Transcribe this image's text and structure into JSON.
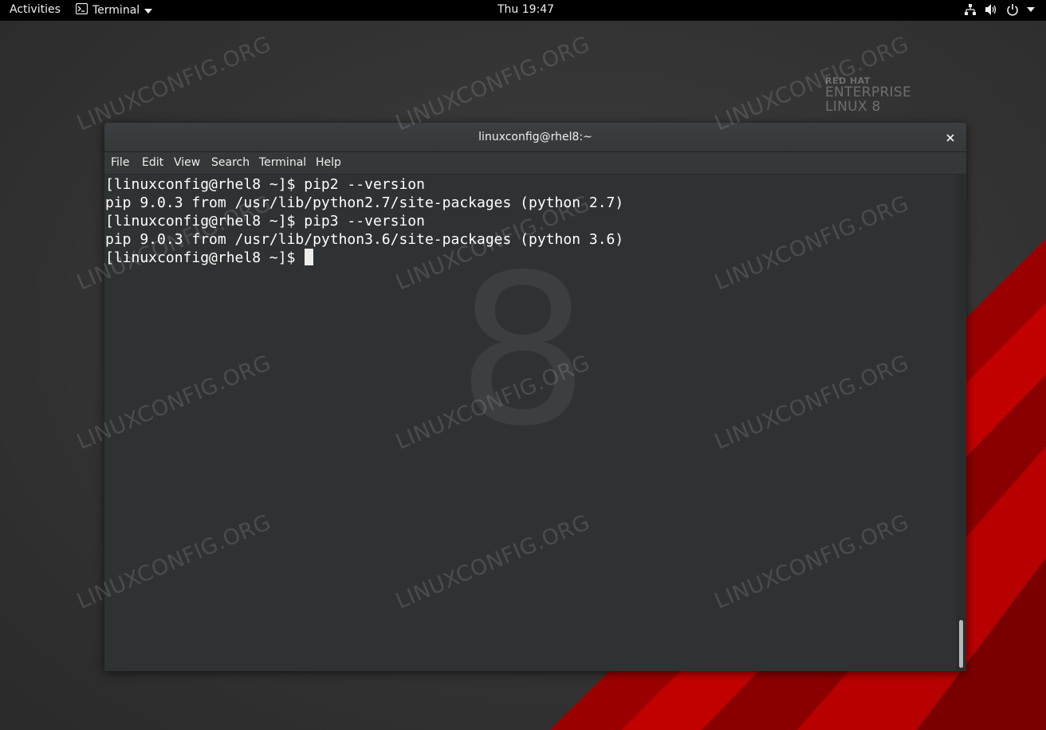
{
  "topbar": {
    "activities": "Activities",
    "app_name": "Terminal",
    "clock": "Thu 19:47",
    "icons": [
      "terminal-icon",
      "network-icon",
      "volume-icon",
      "power-icon",
      "dropdown-arrow-icon"
    ]
  },
  "wallpaper": {
    "brand_line1": "RED HAT",
    "brand_line2": "ENTERPRISE",
    "brand_line3": "LINUX 8",
    "big_numeral": "8",
    "accent_color": "#c00000"
  },
  "watermark": "LINUXCONFIG.ORG",
  "window": {
    "title": "linuxconfig@rhel8:~",
    "menu": [
      "File",
      "Edit",
      "View",
      "Search",
      "Terminal",
      "Help"
    ]
  },
  "terminal": {
    "lines": [
      "[linuxconfig@rhel8 ~]$ pip2 --version",
      "pip 9.0.3 from /usr/lib/python2.7/site-packages (python 2.7)",
      "[linuxconfig@rhel8 ~]$ pip3 --version",
      "pip 9.0.3 from /usr/lib/python3.6/site-packages (python 3.6)",
      "[linuxconfig@rhel8 ~]$ "
    ]
  }
}
